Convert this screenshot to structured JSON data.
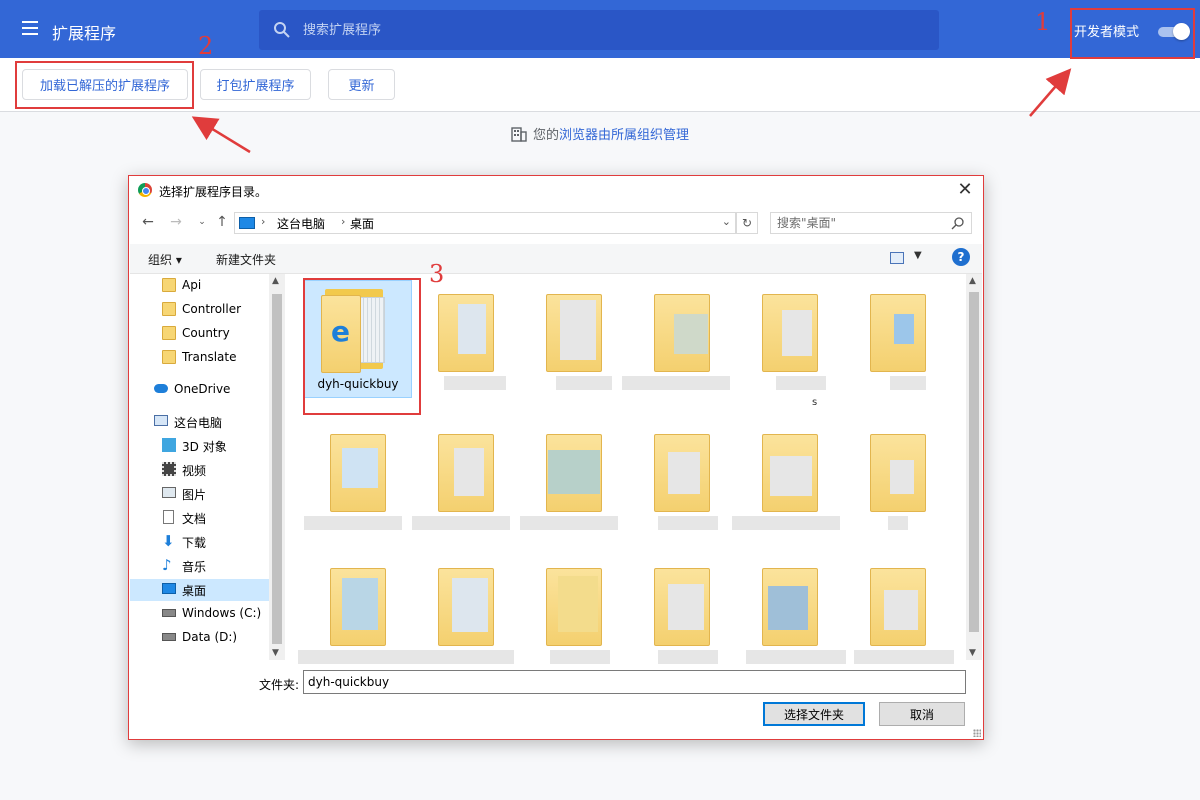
{
  "app": {
    "title": "扩展程序",
    "search_placeholder": "搜索扩展程序",
    "dev_mode_label": "开发者模式",
    "dev_mode_on": true
  },
  "toolbar": {
    "load_unpacked": "加载已解压的扩展程序",
    "pack": "打包扩展程序",
    "update": "更新"
  },
  "managed": {
    "prefix": "您的",
    "link": "浏览器由所属组织管理"
  },
  "annotations": [
    "1",
    "2",
    "3"
  ],
  "dialog": {
    "title": "选择扩展程序目录。",
    "breadcrumb": [
      "这台电脑",
      "桌面"
    ],
    "search_placeholder": "搜索\"桌面\"",
    "organize": "组织 ▾",
    "new_folder": "新建文件夹",
    "help": "?",
    "tree": [
      {
        "label": "Api",
        "icon": "folder-icon"
      },
      {
        "label": "Controller",
        "icon": "folder-icon"
      },
      {
        "label": "Country",
        "icon": "folder-icon"
      },
      {
        "label": "Translate",
        "icon": "folder-icon"
      },
      {
        "label": "OneDrive",
        "icon": "cloud-icon"
      },
      {
        "label": "这台电脑",
        "icon": "computer-icon"
      },
      {
        "label": "3D 对象",
        "icon": "cube-icon"
      },
      {
        "label": "视频",
        "icon": "video-icon"
      },
      {
        "label": "图片",
        "icon": "picture-icon"
      },
      {
        "label": "文档",
        "icon": "document-icon"
      },
      {
        "label": "下载",
        "icon": "download-icon"
      },
      {
        "label": "音乐",
        "icon": "music-icon"
      },
      {
        "label": "桌面",
        "icon": "desktop-icon",
        "selected": true
      },
      {
        "label": "Windows (C:)",
        "icon": "drive-icon"
      },
      {
        "label": "Data (D:)",
        "icon": "drive-icon"
      }
    ],
    "selected_folder": "dyh-quickbuy",
    "stray_label": "s",
    "filename_label": "文件夹:",
    "filename_value": "dyh-quickbuy",
    "select_button": "选择文件夹",
    "cancel_button": "取消",
    "colors": {
      "accent": "#3367d6",
      "annotation": "#e03c3c",
      "selection": "#cce8ff"
    }
  }
}
